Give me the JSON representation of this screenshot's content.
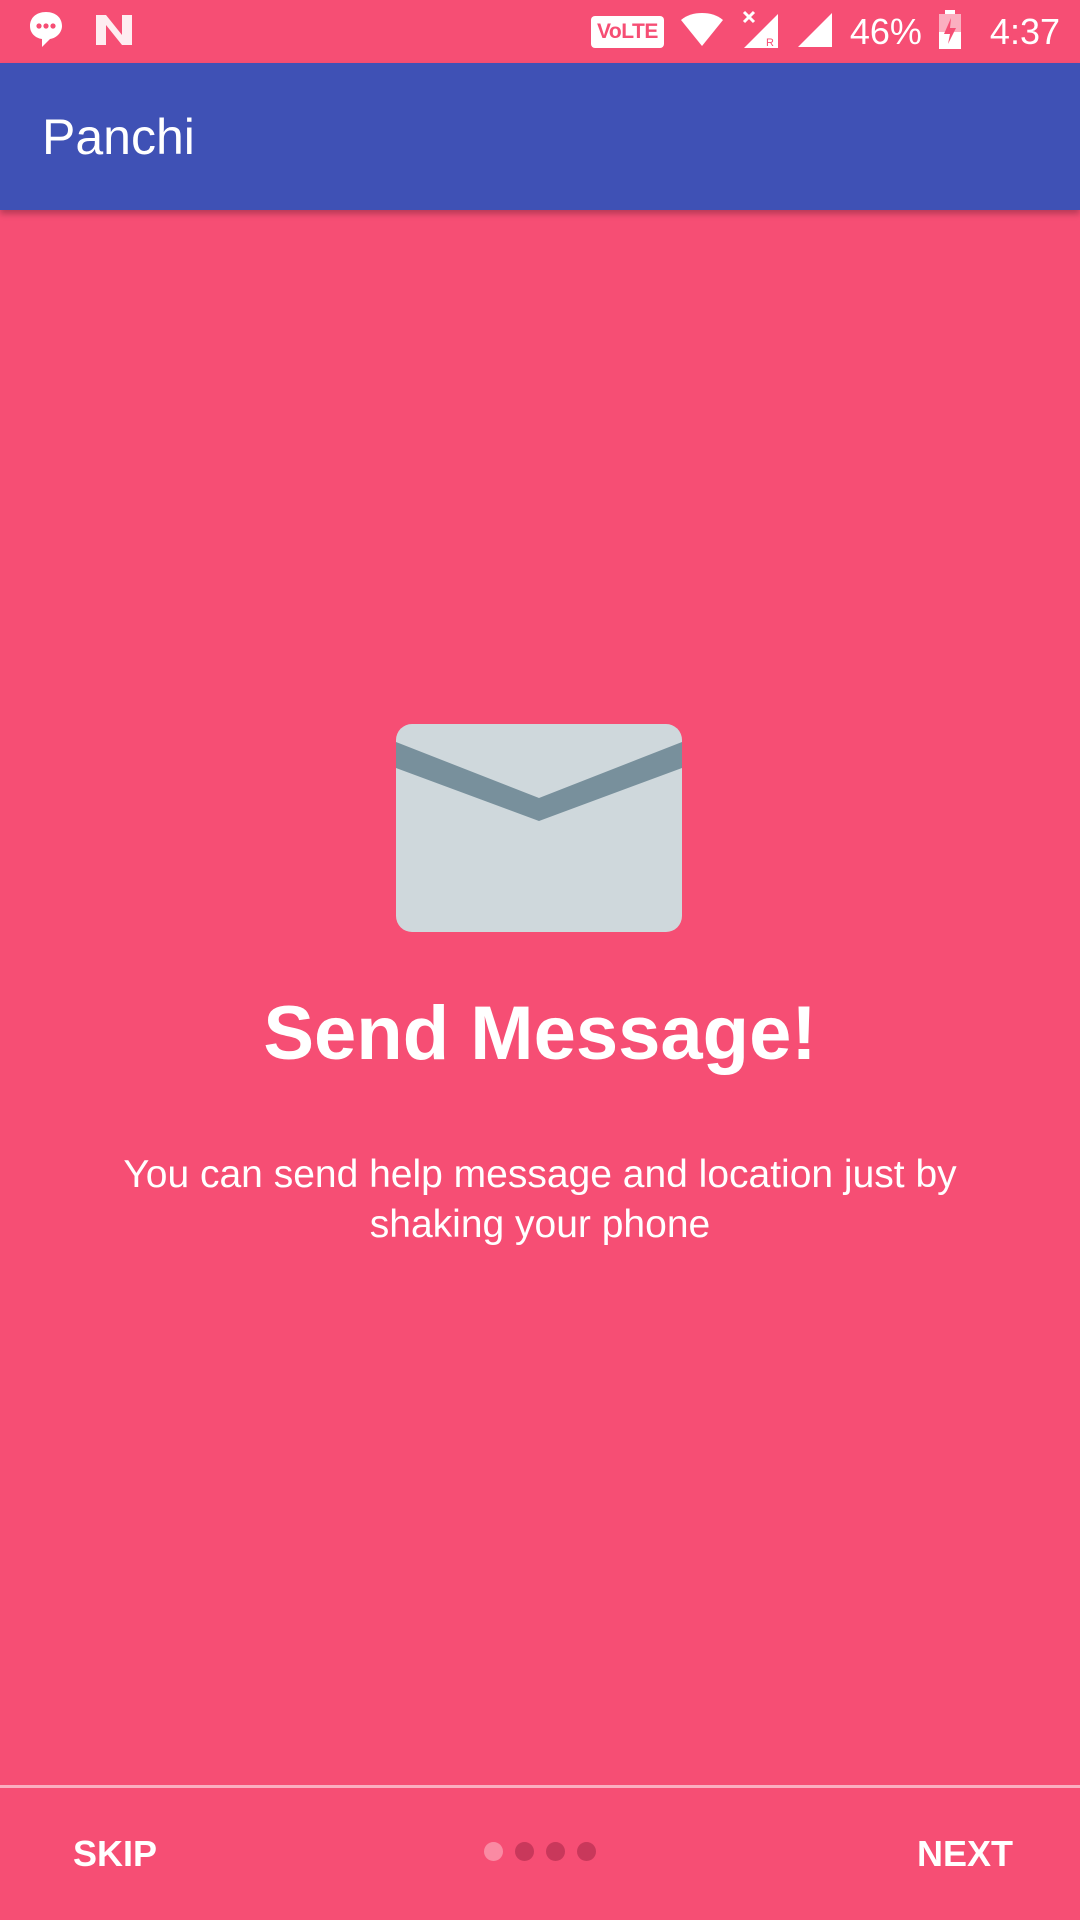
{
  "status_bar": {
    "left_icons": [
      "messaging-icon",
      "n-app-icon"
    ],
    "volte_label": "VoLTE",
    "battery_percent": "46%",
    "time": "4:37"
  },
  "app_bar": {
    "title": "Panchi"
  },
  "slide": {
    "icon": "envelope-icon",
    "title": "Send Message!",
    "description": "You can send help message and location just by shaking your phone"
  },
  "bottom_bar": {
    "skip_label": "SKIP",
    "next_label": "NEXT",
    "page_count": 4,
    "active_page": 1
  },
  "colors": {
    "background": "#F64E74",
    "app_bar": "#3F51B5",
    "envelope_body": "#CFD8DC",
    "envelope_flap": "#78909C"
  }
}
